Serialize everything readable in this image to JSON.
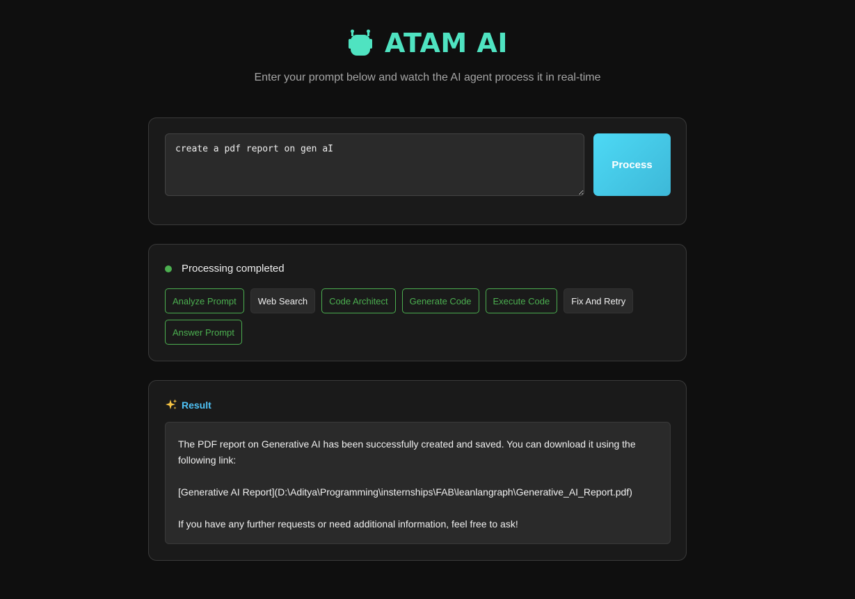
{
  "header": {
    "title": "ATAM AI",
    "icon": "robot-icon",
    "subtitle": "Enter your prompt below and watch the AI agent process it in real-time"
  },
  "input": {
    "value": "create a pdf report on gen aI",
    "process_label": "Process"
  },
  "status": {
    "text": "Processing completed",
    "color": "#4caf50",
    "steps": [
      {
        "label": "Analyze Prompt",
        "state": "done"
      },
      {
        "label": "Web Search",
        "state": "idle"
      },
      {
        "label": "Code Architect",
        "state": "done"
      },
      {
        "label": "Generate Code",
        "state": "done"
      },
      {
        "label": "Execute Code",
        "state": "done"
      },
      {
        "label": "Fix And Retry",
        "state": "idle"
      },
      {
        "label": "Answer Prompt",
        "state": "done"
      }
    ]
  },
  "result": {
    "icon": "sparkle-icon",
    "title": "Result",
    "paragraphs": [
      "The PDF report on Generative AI has been successfully created and saved. You can download it using the following link:",
      "[Generative AI Report](D:\\Aditya\\Programming\\insternships\\FAB\\leanlangraph\\Generative_AI_Report.pdf)",
      "If you have any further requests or need additional information, feel free to ask!"
    ]
  },
  "colors": {
    "accent": "#4fe3c1",
    "button": "#4dd9f5",
    "success": "#4caf50",
    "result_title": "#4fc3f7",
    "background": "#0f0f0f"
  }
}
